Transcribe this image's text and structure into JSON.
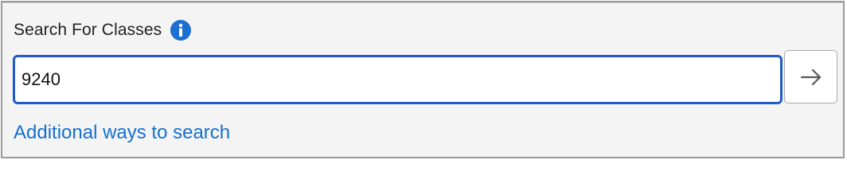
{
  "search": {
    "title": "Search For Classes",
    "info_icon": "info-icon",
    "input_value": "9240",
    "submit_icon": "arrow-right-icon",
    "additional_link": "Additional ways to search"
  },
  "colors": {
    "accent": "#1f5bc6",
    "link": "#1570cf",
    "info_icon": "#1c6fd0",
    "panel_background": "#f4f4f4"
  }
}
